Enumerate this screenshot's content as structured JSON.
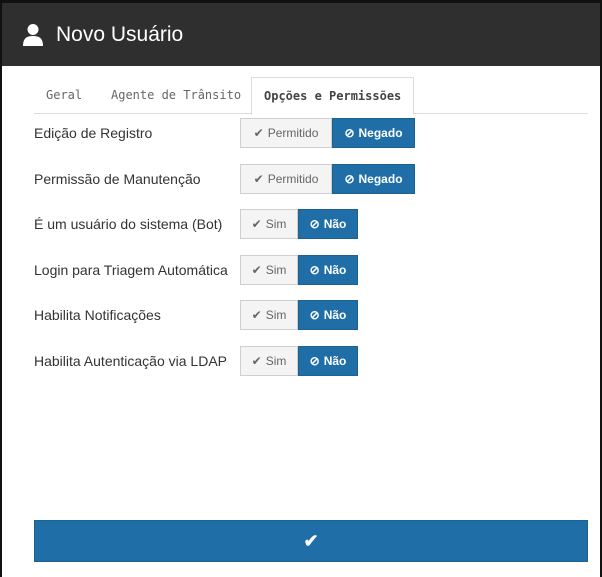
{
  "dialog": {
    "title": "Novo Usuário",
    "icon": "user-icon",
    "header_bg": "#2f2f2f"
  },
  "tabs": [
    {
      "label": "Geral",
      "active": false
    },
    {
      "label": "Agente de Trânsito",
      "active": false
    },
    {
      "label": "Opções e Permissões",
      "active": true
    }
  ],
  "options": [
    {
      "label": "Edição de Registro",
      "yes": "Permitido",
      "no": "Negado",
      "selected": "no"
    },
    {
      "label": "Permissão de Manutenção",
      "yes": "Permitido",
      "no": "Negado",
      "selected": "no"
    },
    {
      "label": "É um usuário do sistema (Bot)",
      "yes": "Sim",
      "no": "Não",
      "selected": "no"
    },
    {
      "label": "Login para Triagem Automática",
      "yes": "Sim",
      "no": "Não",
      "selected": "no"
    },
    {
      "label": "Habilita Notificações",
      "yes": "Sim",
      "no": "Não",
      "selected": "no"
    },
    {
      "label": "Habilita Autenticação via LDAP",
      "yes": "Sim",
      "no": "Não",
      "selected": "no"
    }
  ],
  "icons": {
    "check": "check-icon",
    "ban": "ban-icon"
  },
  "colors": {
    "accent": "#1f6ea8"
  }
}
